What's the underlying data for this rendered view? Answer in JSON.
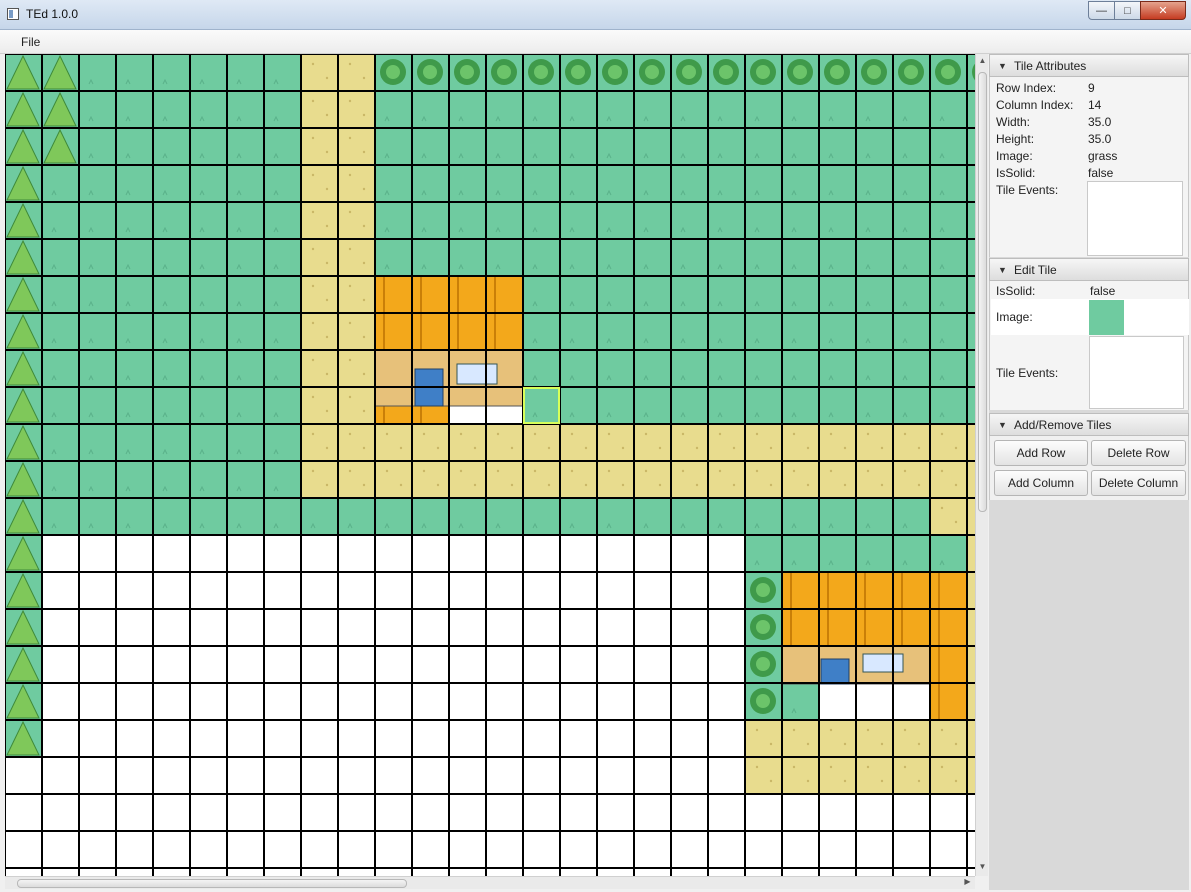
{
  "window": {
    "title": "TEd 1.0.0",
    "controls": {
      "minimize": "—",
      "maximize": "□",
      "close": "✕"
    }
  },
  "menu": {
    "file": "File"
  },
  "map": {
    "rows": 23,
    "cols": 27,
    "selected_cell": {
      "row": 9,
      "col": 14
    },
    "colors": {
      "grass": "#6fcba0",
      "sand": "#e8dc8e",
      "empty": "#ffffff",
      "grid": "#000000",
      "tree": "#7fc85a",
      "bush": "#3f9a4a",
      "roof": "#f3a81b",
      "wall": "#e7c17a",
      "door": "#3f7fc7"
    },
    "tiles": [
      "TTggggggssbbbbbbbbbbbbbbbbb",
      "TTggggggssggggggggggggggggg",
      "TTggggggssggggggggggggggggg",
      "Tgggggggssggggggggggggggggg",
      "Tgggggggssggggggggggggggggg",
      "Tgggggggssggggggggggggggggg",
      "TgggggggssHHHHggggggggggggg",
      "TgggggggssHHHHggggggggggggg",
      "TgggggggssHHHHggggggggggggg",
      "TgggggggssHHeegggggggggggggg",
      "Tgggggggssssssssssssssssssss",
      "Tgggggggssssssssssssssssssss",
      "Tggggggggggggggggggggggggsss",
      "Teeeeeeeeeeeeeeeeeeeggggggss",
      "TeeeeeeeeeeeeeeeeeeebHHHHHss",
      "TeeeeeeeeeeeeeeeeeeebHHHHHss",
      "TeeeeeeeeeeeeeeeeeeebHHHHHss",
      "TeeeeeeeeeeeeeeeeeeebgeeeHss",
      "TeeeeeeeeeeeeeeeeeeessssssSs",
      "eeeeeeeeeeeeeeeeeeeessssssss",
      "eeeeeeeeeeeeeeeeeeeeeeeeeeee",
      "eeeeeeeeeeeeeeeeeeeeeeeeeeee",
      "eeeeeeeeeeeeeeeeeeeeeeeeeeee"
    ]
  },
  "tile_attributes": {
    "header": "Tile Attributes",
    "row_index_label": "Row Index:",
    "row_index": "9",
    "column_index_label": "Column Index:",
    "column_index": "14",
    "width_label": "Width:",
    "width": "35.0",
    "height_label": "Height:",
    "height": "35.0",
    "image_label": "Image:",
    "image": "grass",
    "issolid_label": "IsSolid:",
    "issolid": "false",
    "events_label": "Tile Events:"
  },
  "edit_tile": {
    "header": "Edit Tile",
    "issolid_label": "IsSolid:",
    "issolid": "false",
    "image_label": "Image:",
    "events_label": "Tile Events:"
  },
  "add_remove": {
    "header": "Add/Remove Tiles",
    "add_row": "Add Row",
    "delete_row": "Delete Row",
    "add_column": "Add Column",
    "delete_column": "Delete Column"
  }
}
